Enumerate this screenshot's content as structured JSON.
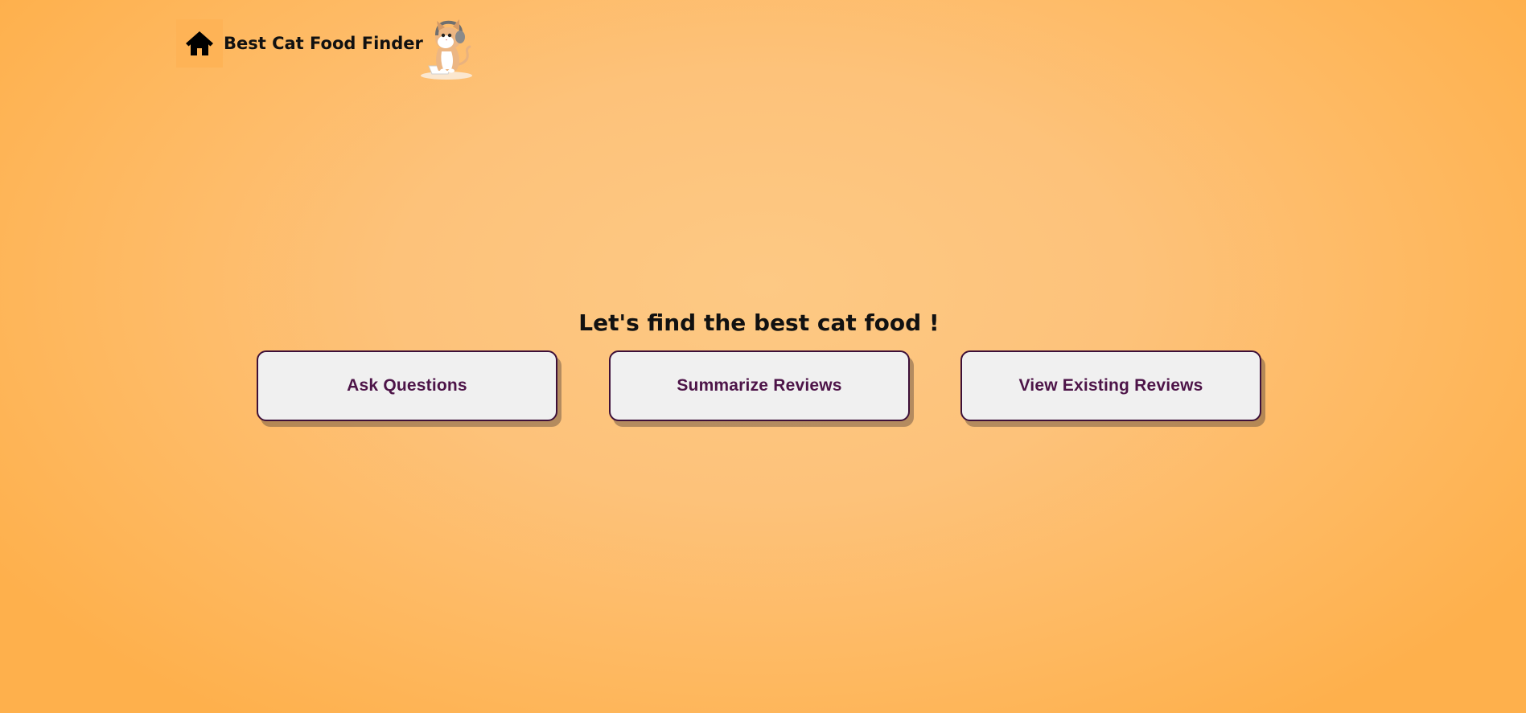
{
  "header": {
    "app_title": "Best Cat Food Finder",
    "home_icon": "home-icon",
    "mascot_icon": "cat-mascot-illustration"
  },
  "main": {
    "heading": "Let's find the best cat food !",
    "buttons": [
      {
        "label": "Ask Questions"
      },
      {
        "label": "Summarize Reviews"
      },
      {
        "label": "View Existing Reviews"
      }
    ]
  },
  "colors": {
    "background": "#fdc27a",
    "home_button_bg": "#feb356",
    "button_bg": "#f0f0f0",
    "button_border": "#3d1039",
    "button_text": "#4d1448"
  }
}
